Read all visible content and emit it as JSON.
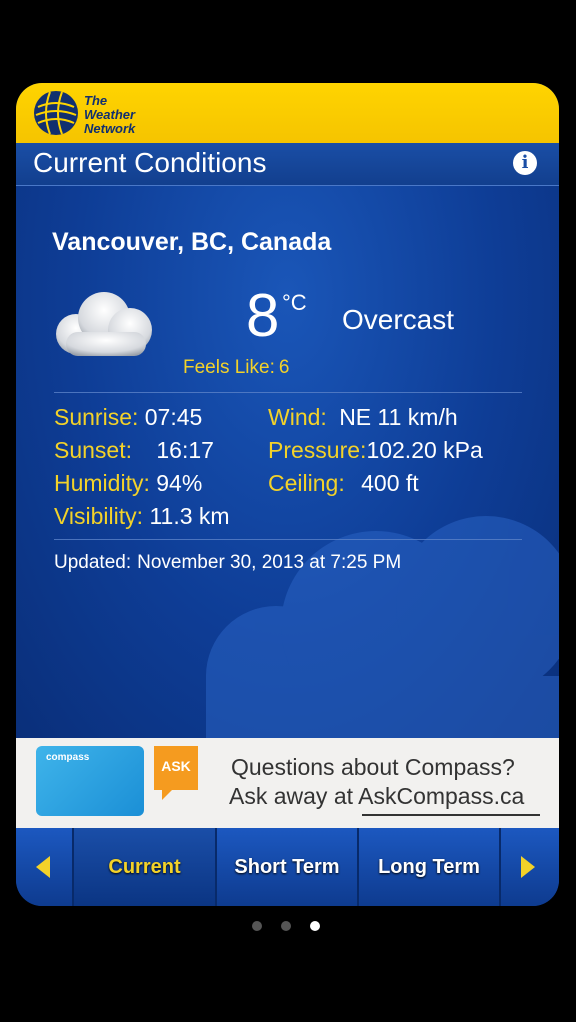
{
  "brand": {
    "name_line1": "The",
    "name_line2": "Weather",
    "name_line3": "Network"
  },
  "header": {
    "title": "Current Conditions",
    "info_icon": "info-icon"
  },
  "current": {
    "location": "Vancouver, BC, Canada",
    "icon": "cloud-icon",
    "temperature": "8",
    "unit": "°C",
    "condition": "Overcast",
    "feels_like_label": "Feels Like:",
    "feels_like_value": "6"
  },
  "stats": {
    "sunrise_label": "Sunrise:",
    "sunrise_value": "07:45",
    "sunset_label": "Sunset:",
    "sunset_value": "16:17",
    "humidity_label": "Humidity:",
    "humidity_value": "94%",
    "visibility_label": "Visibility:",
    "visibility_value": "11.3 km",
    "wind_label": "Wind:",
    "wind_value": "NE 11 km/h",
    "pressure_label": "Pressure:",
    "pressure_value": "102.20 kPa",
    "ceiling_label": "Ceiling:",
    "ceiling_value": "400 ft"
  },
  "updated": {
    "label": "Updated:",
    "value": "November 30, 2013 at 7:25 PM"
  },
  "ad": {
    "card_text": "compass",
    "ask_badge": "ASK",
    "line1": "Questions about Compass?",
    "line2": "Ask away at AskCompass.ca"
  },
  "tabs": [
    {
      "label": "Current",
      "active": true
    },
    {
      "label": "Short Term",
      "active": false
    },
    {
      "label": "Long Term",
      "active": false
    }
  ],
  "pagination": {
    "total": 3,
    "active_index": 2
  },
  "colors": {
    "brand_yellow": "#ffd400",
    "label_yellow": "#f3d229",
    "panel_blue": "#0e3d96"
  }
}
